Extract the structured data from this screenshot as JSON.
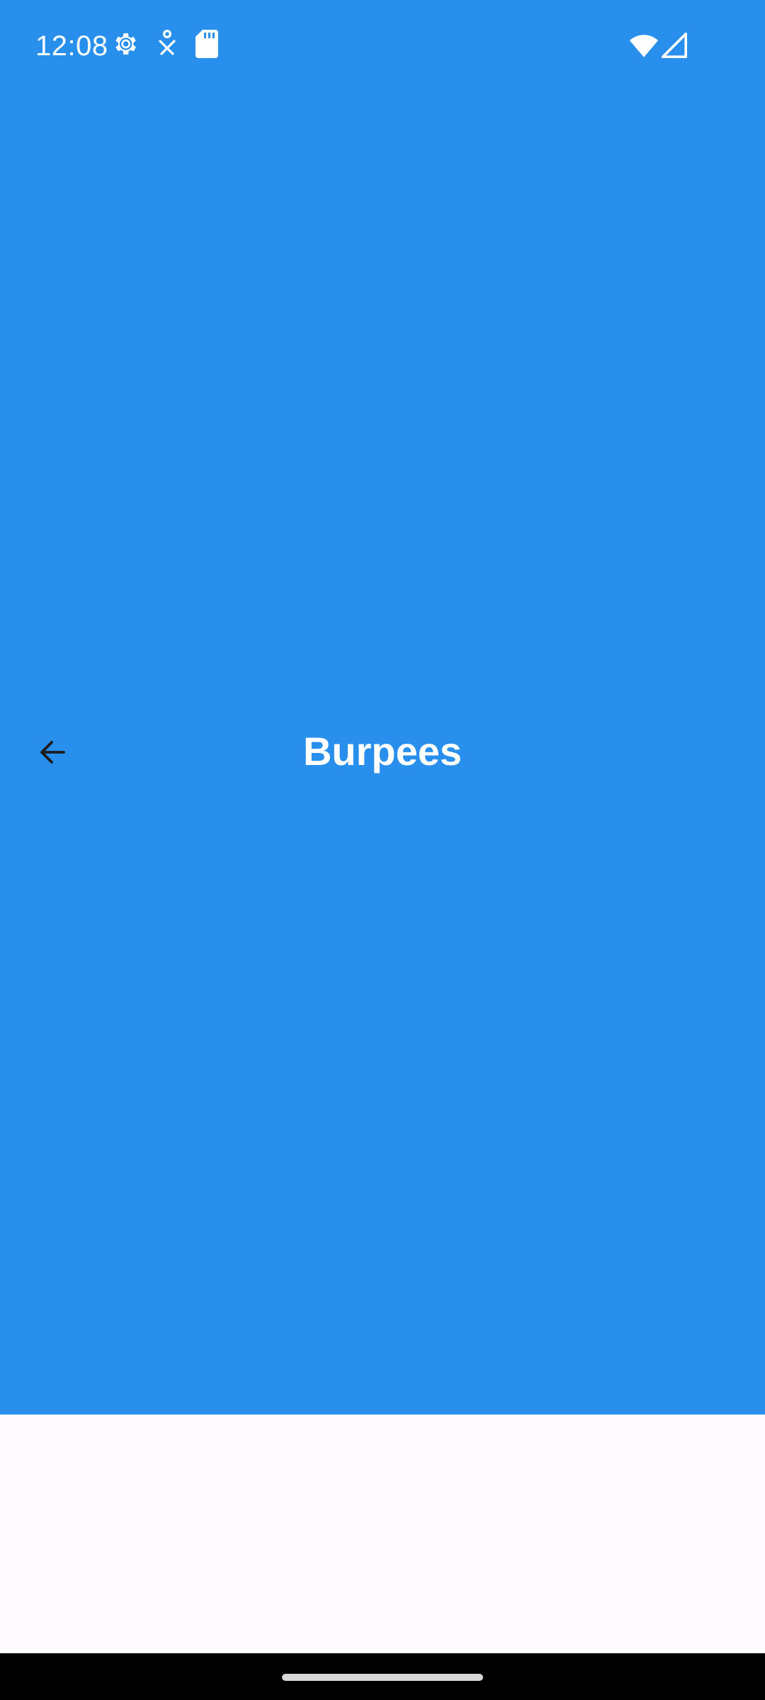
{
  "status_bar": {
    "time": "12:08",
    "icons": [
      "gear-icon",
      "accessibility-icon",
      "sd-card-icon",
      "wifi-icon",
      "cellular-signal-icon"
    ]
  },
  "toolbar": {
    "title": "Burpees",
    "back_icon": "arrow-back-icon"
  },
  "colors": {
    "header_background": "#2890ec",
    "content_background": "#fefaff",
    "title_text": "#ffffff",
    "back_icon": "#1c1b1f",
    "nav_bar": "#000000"
  }
}
